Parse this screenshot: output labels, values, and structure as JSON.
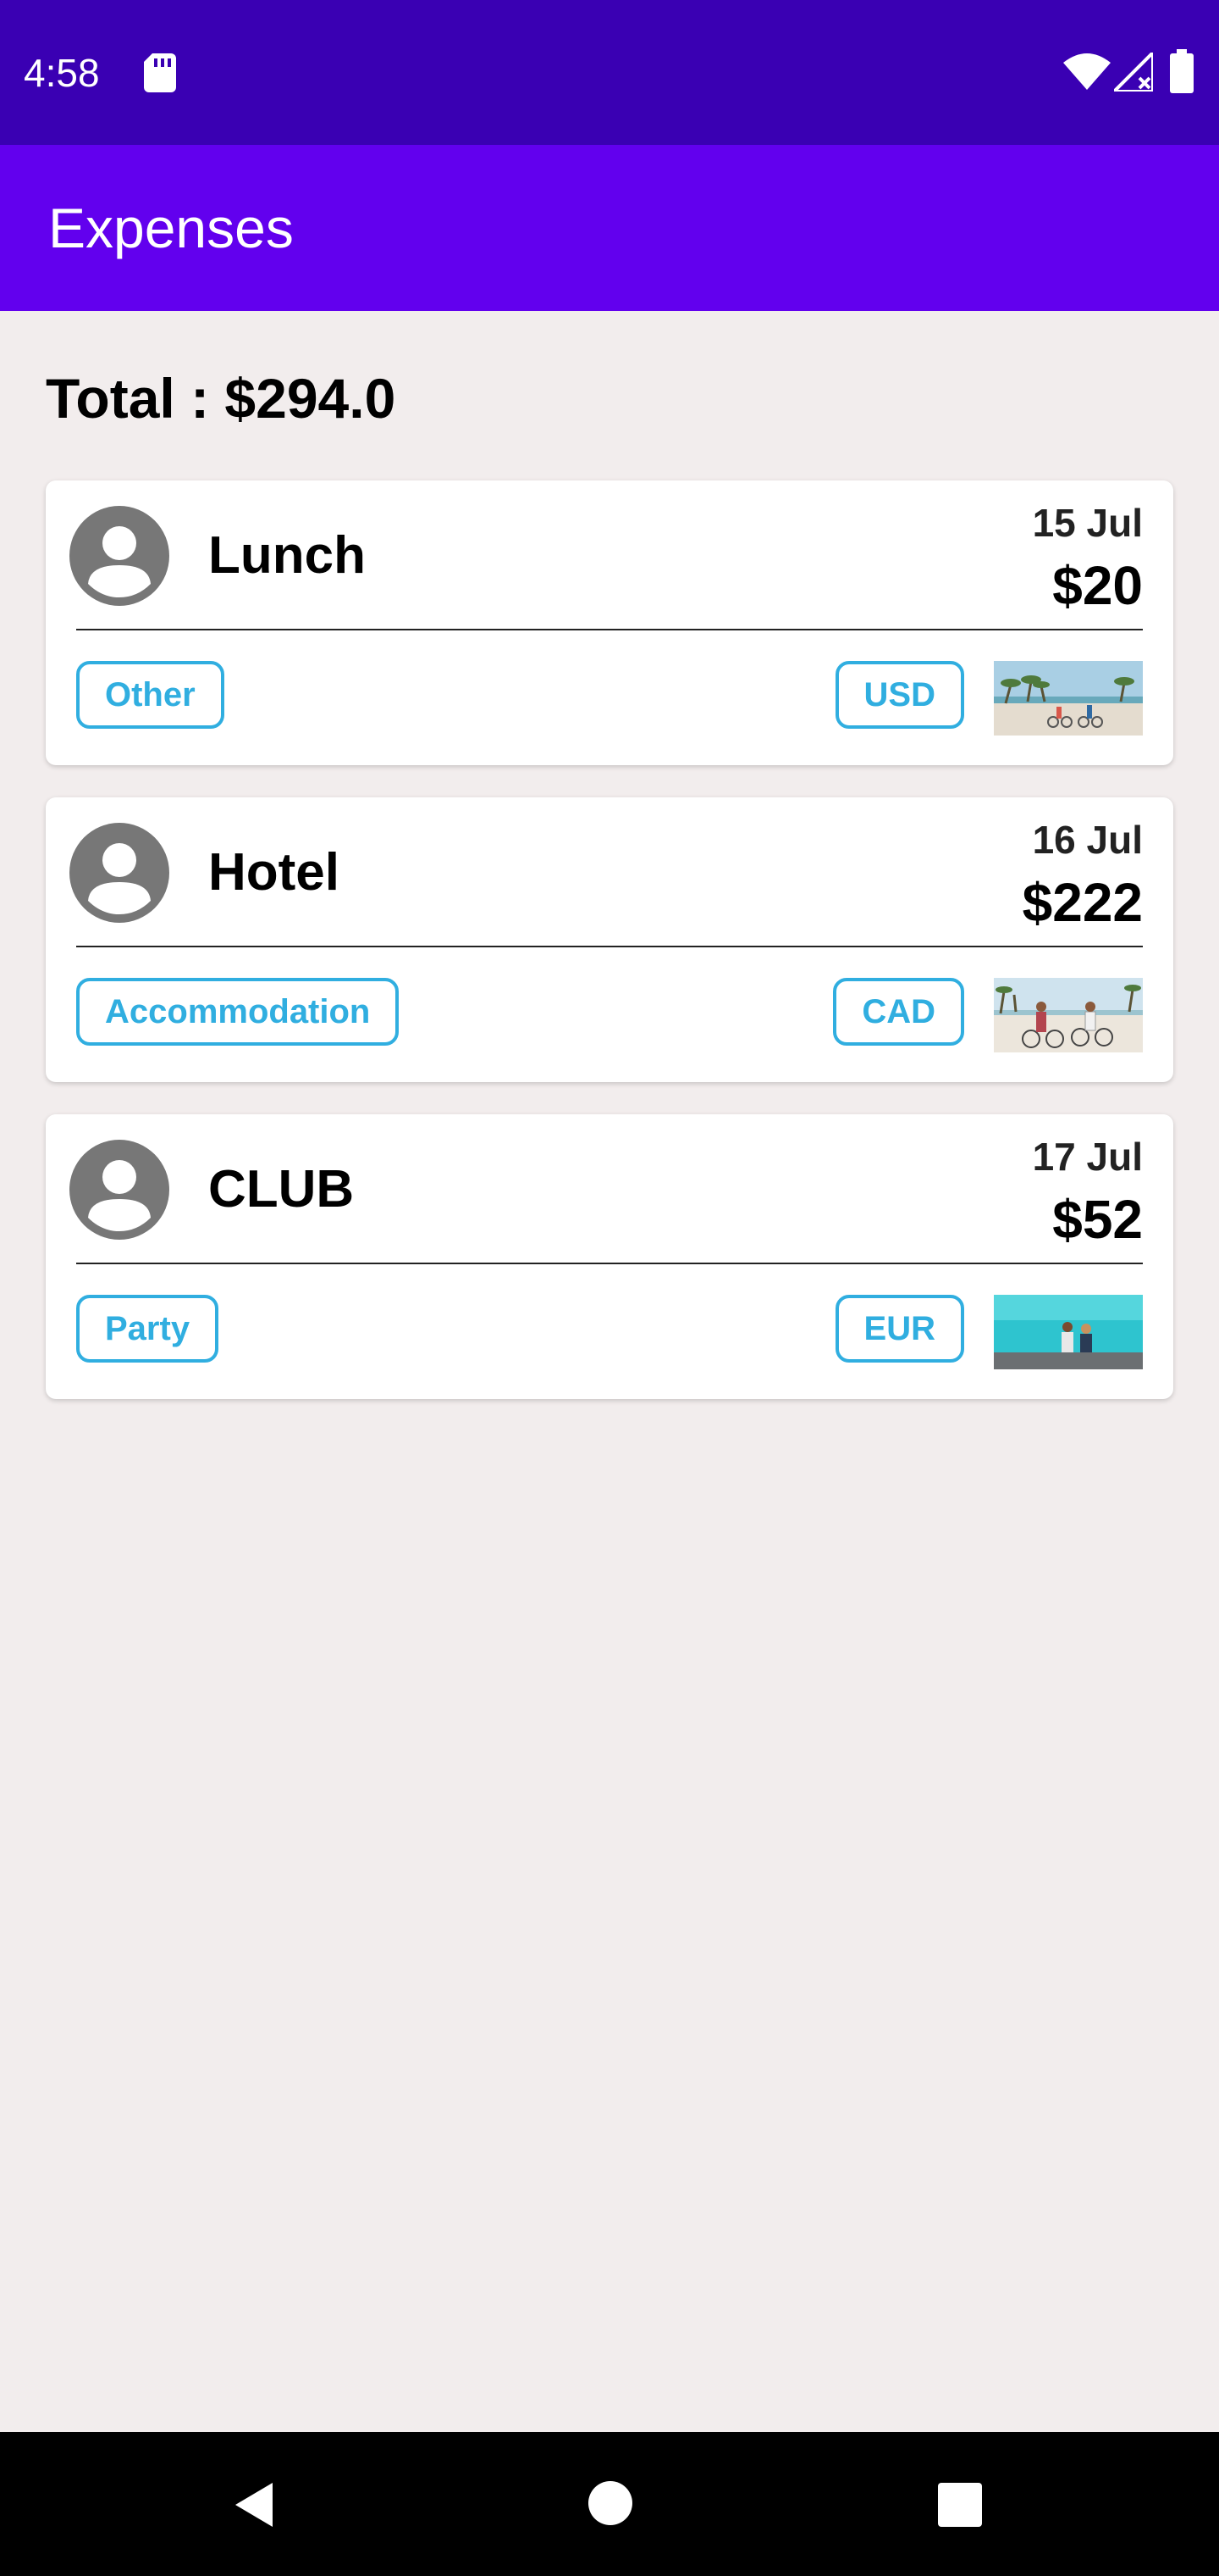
{
  "status_bar": {
    "time": "4:58",
    "icons": [
      "sd-card-icon",
      "wifi-icon",
      "signal-icon",
      "battery-icon"
    ]
  },
  "app_bar": {
    "title": "Expenses"
  },
  "total": {
    "text": "Total : $294.0"
  },
  "expenses": [
    {
      "title": "Lunch",
      "date": "15 Jul",
      "amount": "$20",
      "category": "Other",
      "currency": "USD",
      "image": "beach-palms-photo"
    },
    {
      "title": "Hotel",
      "date": "16 Jul",
      "amount": "$222",
      "category": "Accommodation",
      "currency": "CAD",
      "image": "beach-cyclists-photo"
    },
    {
      "title": "CLUB",
      "date": "17 Jul",
      "amount": "$52",
      "category": "Party",
      "currency": "EUR",
      "image": "ocean-couple-photo"
    }
  ],
  "colors": {
    "status_bar": "#3a00b3",
    "app_bar": "#6200ee",
    "background": "#f2eded",
    "chip_accent": "#30aee0"
  },
  "nav_bar": {
    "icons": [
      "back-icon",
      "home-icon",
      "recents-icon"
    ]
  }
}
